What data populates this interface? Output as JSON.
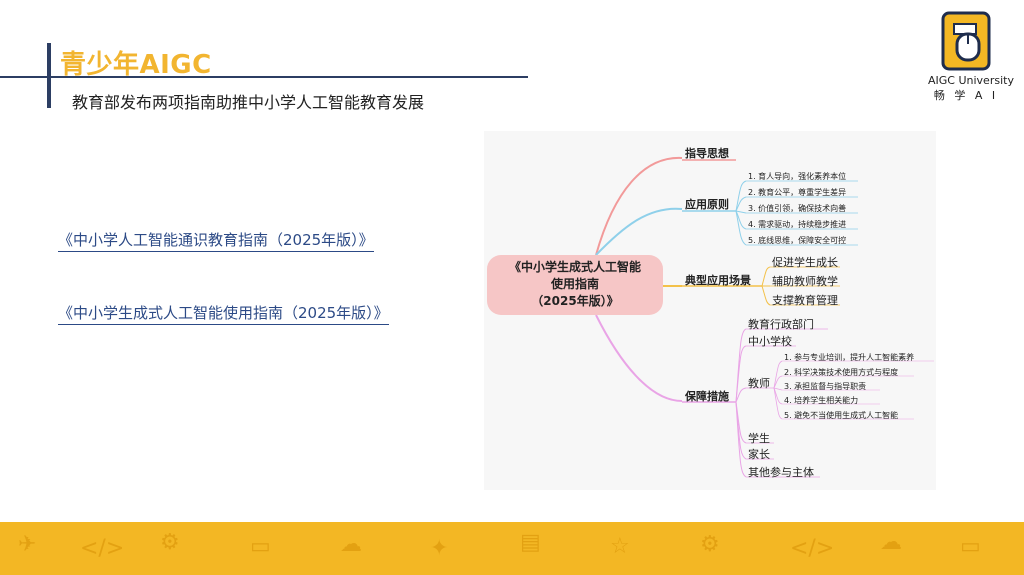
{
  "header": {
    "title": "青少年AIGC",
    "subtitle": "教育部发布两项指南助推中小学人工智能教育发展"
  },
  "logo": {
    "name": "AIGC University",
    "sub": "畅 学 A I"
  },
  "links": [
    "《中小学人工智能通识教育指南（2025年版）》",
    "《中小学生成式人工智能使用指南（2025年版）》"
  ],
  "mindmap": {
    "root_line1": "《中小学生成式人工智能",
    "root_line2": "使用指南",
    "root_line3": "（2025年版）》",
    "branch_guiding": "指导思想",
    "branch_principles": "应用原则",
    "principles": [
      "1. 育人导向，强化素养本位",
      "2. 教育公平，尊重学生差异",
      "3. 价值引领，确保技术向善",
      "4. 需求驱动，持续稳步推进",
      "5. 底线思维，保障安全可控"
    ],
    "branch_scenarios": "典型应用场景",
    "scenarios": [
      "促进学生成长",
      "辅助教师教学",
      "支撑教育管理"
    ],
    "branch_measures": "保障措施",
    "measures": {
      "admin": "教育行政部门",
      "schools": "中小学校",
      "teachers": "教师",
      "teacher_items": [
        "1. 参与专业培训，提升人工智能素养",
        "2. 科学决策技术使用方式与程度",
        "3. 承担监督与指导职责",
        "4. 培养学生相关能力",
        "5. 避免不当使用生成式人工智能"
      ],
      "students": "学生",
      "parents": "家长",
      "others": "其他参与主体"
    }
  },
  "colors": {
    "title": "#f2b530",
    "header_line": "#2c3e63",
    "link": "#2c4a86",
    "footer": "#f3b724",
    "root_fill": "#f6c6c6"
  }
}
